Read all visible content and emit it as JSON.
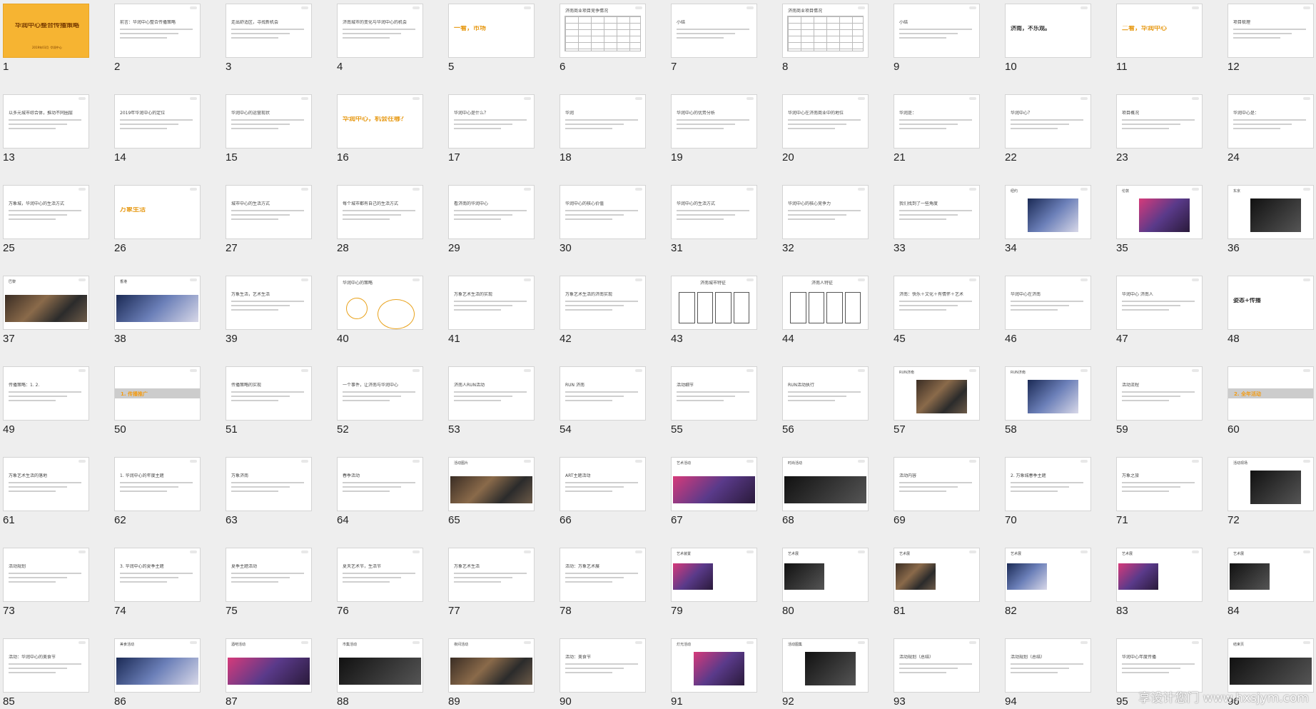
{
  "slides": [
    {
      "n": "1",
      "style": "orange",
      "title": "华润中心整合传播策略",
      "subtitle": "2019年03月 ·华润中心"
    },
    {
      "n": "2",
      "style": "text",
      "title": "前言：华润中心整合传播策略"
    },
    {
      "n": "3",
      "style": "text",
      "title": "走出舒适区，寻找新机会"
    },
    {
      "n": "4",
      "style": "text",
      "title": "济南城市的变化与华润中心的机会"
    },
    {
      "n": "5",
      "style": "big",
      "title": "一看，市场"
    },
    {
      "n": "6",
      "style": "table",
      "title": "济南商业项目竞争情况"
    },
    {
      "n": "7",
      "style": "text",
      "title": "小结"
    },
    {
      "n": "8",
      "style": "table",
      "title": "济南商业项目情况"
    },
    {
      "n": "9",
      "style": "text",
      "title": "小结"
    },
    {
      "n": "10",
      "style": "dark",
      "title": "济南，不乐观。"
    },
    {
      "n": "11",
      "style": "big",
      "title": "二看，华润中心"
    },
    {
      "n": "12",
      "style": "text",
      "title": "项目梳理"
    },
    {
      "n": "13",
      "style": "text",
      "title": "以多元城市综合体，推动不同圈层"
    },
    {
      "n": "14",
      "style": "text",
      "title": "2019年华润中心的定位"
    },
    {
      "n": "15",
      "style": "text",
      "title": "华润中心的运营现状"
    },
    {
      "n": "16",
      "style": "big",
      "title": "华润中心，机会在哪？"
    },
    {
      "n": "17",
      "style": "text",
      "title": "华润中心是什么？"
    },
    {
      "n": "18",
      "style": "text",
      "title": "华润"
    },
    {
      "n": "19",
      "style": "text",
      "title": "华润中心的优势分析"
    },
    {
      "n": "20",
      "style": "text",
      "title": "华润中心在济南商业中的地位"
    },
    {
      "n": "21",
      "style": "text",
      "title": "华润是："
    },
    {
      "n": "22",
      "style": "text",
      "title": "华润中心？"
    },
    {
      "n": "23",
      "style": "text",
      "title": "项目概况"
    },
    {
      "n": "24",
      "style": "text",
      "title": "华润中心是："
    },
    {
      "n": "25",
      "style": "text",
      "title": "万象城，华润中心的生活方式"
    },
    {
      "n": "26",
      "style": "big",
      "title": "万象生活"
    },
    {
      "n": "27",
      "style": "text",
      "title": "城市中心的生活方式"
    },
    {
      "n": "28",
      "style": "text",
      "title": "每个城市都有自己的生活方式"
    },
    {
      "n": "29",
      "style": "text",
      "title": "看济南的华润中心"
    },
    {
      "n": "30",
      "style": "text",
      "title": "华润中心的核心价值"
    },
    {
      "n": "31",
      "style": "text",
      "title": "华润中心的生活方式"
    },
    {
      "n": "32",
      "style": "text",
      "title": "华润中心的核心竞争力"
    },
    {
      "n": "33",
      "style": "text",
      "title": "我们找到了一些角度"
    },
    {
      "n": "34",
      "style": "photo",
      "title": "纽约"
    },
    {
      "n": "35",
      "style": "photo",
      "title": "伦敦"
    },
    {
      "n": "36",
      "style": "photo",
      "title": "东京"
    },
    {
      "n": "37",
      "style": "photowide",
      "title": "巴黎"
    },
    {
      "n": "38",
      "style": "photowide",
      "title": "香港"
    },
    {
      "n": "39",
      "style": "text",
      "title": "万象生活，艺术生活"
    },
    {
      "n": "40",
      "style": "circles",
      "title": "华润中心的策略"
    },
    {
      "n": "41",
      "style": "text",
      "title": "万象艺术生活的实现"
    },
    {
      "n": "42",
      "style": "text",
      "title": "万象艺术生活的济南实现"
    },
    {
      "n": "43",
      "style": "boxes",
      "title": "济南城市特征"
    },
    {
      "n": "44",
      "style": "boxes",
      "title": "济南人特征"
    },
    {
      "n": "45",
      "style": "text",
      "title": "济南：快乐＋文化＋有情怀＋艺术"
    },
    {
      "n": "46",
      "style": "text",
      "title": "华润中心在济南"
    },
    {
      "n": "47",
      "style": "text",
      "title": "华润中心 济南人"
    },
    {
      "n": "48",
      "style": "dark",
      "title": "姿态+传播"
    },
    {
      "n": "49",
      "style": "text",
      "title": "传播策略：1. 2."
    },
    {
      "n": "50",
      "style": "band",
      "title": "1. 传播推广"
    },
    {
      "n": "51",
      "style": "text",
      "title": "传播策略的实现"
    },
    {
      "n": "52",
      "style": "text",
      "title": "一个事件，让济南与华润中心"
    },
    {
      "n": "53",
      "style": "text",
      "title": "济南人RUN活动"
    },
    {
      "n": "54",
      "style": "text",
      "title": "RUN 济南"
    },
    {
      "n": "55",
      "style": "text",
      "title": "活动细节"
    },
    {
      "n": "56",
      "style": "text",
      "title": "RUN活动执行"
    },
    {
      "n": "57",
      "style": "photo",
      "title": "RUN济南"
    },
    {
      "n": "58",
      "style": "photo",
      "title": "RUN济南"
    },
    {
      "n": "59",
      "style": "text",
      "title": "活动流程"
    },
    {
      "n": "60",
      "style": "band",
      "title": "2. 全年活动"
    },
    {
      "n": "61",
      "style": "text",
      "title": "万象艺术生活的落地"
    },
    {
      "n": "62",
      "style": "text",
      "title": "1. 华润中心的年度主题"
    },
    {
      "n": "63",
      "style": "text",
      "title": "万象济南"
    },
    {
      "n": "64",
      "style": "text",
      "title": "春季活动"
    },
    {
      "n": "65",
      "style": "photowide",
      "title": "活动图片"
    },
    {
      "n": "66",
      "style": "text",
      "title": "ART主题活动"
    },
    {
      "n": "67",
      "style": "photowide",
      "title": "艺术活动"
    },
    {
      "n": "68",
      "style": "photowide",
      "title": "时尚活动"
    },
    {
      "n": "69",
      "style": "text",
      "title": "活动内容"
    },
    {
      "n": "70",
      "style": "text",
      "title": "2. 万象城春季主题"
    },
    {
      "n": "71",
      "style": "text",
      "title": "万象之旅"
    },
    {
      "n": "72",
      "style": "photo",
      "title": "活动现场"
    },
    {
      "n": "73",
      "style": "text",
      "title": "活动规划"
    },
    {
      "n": "74",
      "style": "text",
      "title": "3. 华润中心的夏季主题"
    },
    {
      "n": "75",
      "style": "text",
      "title": "夏季主题活动"
    },
    {
      "n": "76",
      "style": "text",
      "title": "夏天艺术节，生活节"
    },
    {
      "n": "77",
      "style": "text",
      "title": "万象艺术生活"
    },
    {
      "n": "78",
      "style": "text",
      "title": "活动：万象艺术展"
    },
    {
      "n": "79",
      "style": "photosmall",
      "title": "艺术装置"
    },
    {
      "n": "80",
      "style": "photosmall",
      "title": "艺术展"
    },
    {
      "n": "81",
      "style": "photosmall",
      "title": "艺术展"
    },
    {
      "n": "82",
      "style": "photosmall",
      "title": "艺术展"
    },
    {
      "n": "83",
      "style": "photosmall",
      "title": "艺术展"
    },
    {
      "n": "84",
      "style": "photosmall",
      "title": "艺术展"
    },
    {
      "n": "85",
      "style": "text",
      "title": "活动：华润中心的美食节"
    },
    {
      "n": "86",
      "style": "photowide",
      "title": "美食活动"
    },
    {
      "n": "87",
      "style": "photowide",
      "title": "酒吧活动"
    },
    {
      "n": "88",
      "style": "photowide",
      "title": "市集活动"
    },
    {
      "n": "89",
      "style": "photowide",
      "title": "夜间活动"
    },
    {
      "n": "90",
      "style": "text",
      "title": "活动：美食节"
    },
    {
      "n": "91",
      "style": "photo",
      "title": "灯光活动"
    },
    {
      "n": "92",
      "style": "photo",
      "title": "活动图集"
    },
    {
      "n": "93",
      "style": "text",
      "title": "活动规划（总结）"
    },
    {
      "n": "94",
      "style": "text",
      "title": "活动规划（总结）"
    },
    {
      "n": "95",
      "style": "text",
      "title": "华润中心年度传播"
    },
    {
      "n": "96",
      "style": "photowide",
      "title": "结束页"
    }
  ],
  "watermark": "享设计您门 www.hxsjym.com",
  "colors": {
    "accent": "#f6b432",
    "background": "#eeeeee"
  }
}
